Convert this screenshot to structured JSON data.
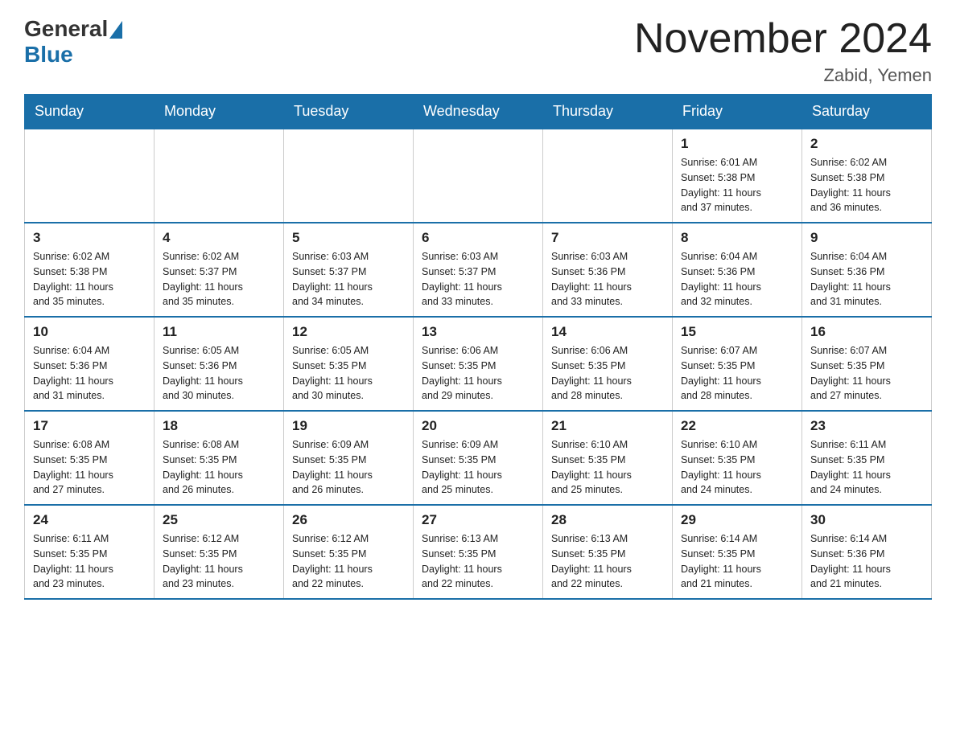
{
  "logo": {
    "general": "General",
    "blue": "Blue"
  },
  "title": "November 2024",
  "location": "Zabid, Yemen",
  "days_of_week": [
    "Sunday",
    "Monday",
    "Tuesday",
    "Wednesday",
    "Thursday",
    "Friday",
    "Saturday"
  ],
  "weeks": [
    [
      {
        "day": "",
        "info": ""
      },
      {
        "day": "",
        "info": ""
      },
      {
        "day": "",
        "info": ""
      },
      {
        "day": "",
        "info": ""
      },
      {
        "day": "",
        "info": ""
      },
      {
        "day": "1",
        "info": "Sunrise: 6:01 AM\nSunset: 5:38 PM\nDaylight: 11 hours\nand 37 minutes."
      },
      {
        "day": "2",
        "info": "Sunrise: 6:02 AM\nSunset: 5:38 PM\nDaylight: 11 hours\nand 36 minutes."
      }
    ],
    [
      {
        "day": "3",
        "info": "Sunrise: 6:02 AM\nSunset: 5:38 PM\nDaylight: 11 hours\nand 35 minutes."
      },
      {
        "day": "4",
        "info": "Sunrise: 6:02 AM\nSunset: 5:37 PM\nDaylight: 11 hours\nand 35 minutes."
      },
      {
        "day": "5",
        "info": "Sunrise: 6:03 AM\nSunset: 5:37 PM\nDaylight: 11 hours\nand 34 minutes."
      },
      {
        "day": "6",
        "info": "Sunrise: 6:03 AM\nSunset: 5:37 PM\nDaylight: 11 hours\nand 33 minutes."
      },
      {
        "day": "7",
        "info": "Sunrise: 6:03 AM\nSunset: 5:36 PM\nDaylight: 11 hours\nand 33 minutes."
      },
      {
        "day": "8",
        "info": "Sunrise: 6:04 AM\nSunset: 5:36 PM\nDaylight: 11 hours\nand 32 minutes."
      },
      {
        "day": "9",
        "info": "Sunrise: 6:04 AM\nSunset: 5:36 PM\nDaylight: 11 hours\nand 31 minutes."
      }
    ],
    [
      {
        "day": "10",
        "info": "Sunrise: 6:04 AM\nSunset: 5:36 PM\nDaylight: 11 hours\nand 31 minutes."
      },
      {
        "day": "11",
        "info": "Sunrise: 6:05 AM\nSunset: 5:36 PM\nDaylight: 11 hours\nand 30 minutes."
      },
      {
        "day": "12",
        "info": "Sunrise: 6:05 AM\nSunset: 5:35 PM\nDaylight: 11 hours\nand 30 minutes."
      },
      {
        "day": "13",
        "info": "Sunrise: 6:06 AM\nSunset: 5:35 PM\nDaylight: 11 hours\nand 29 minutes."
      },
      {
        "day": "14",
        "info": "Sunrise: 6:06 AM\nSunset: 5:35 PM\nDaylight: 11 hours\nand 28 minutes."
      },
      {
        "day": "15",
        "info": "Sunrise: 6:07 AM\nSunset: 5:35 PM\nDaylight: 11 hours\nand 28 minutes."
      },
      {
        "day": "16",
        "info": "Sunrise: 6:07 AM\nSunset: 5:35 PM\nDaylight: 11 hours\nand 27 minutes."
      }
    ],
    [
      {
        "day": "17",
        "info": "Sunrise: 6:08 AM\nSunset: 5:35 PM\nDaylight: 11 hours\nand 27 minutes."
      },
      {
        "day": "18",
        "info": "Sunrise: 6:08 AM\nSunset: 5:35 PM\nDaylight: 11 hours\nand 26 minutes."
      },
      {
        "day": "19",
        "info": "Sunrise: 6:09 AM\nSunset: 5:35 PM\nDaylight: 11 hours\nand 26 minutes."
      },
      {
        "day": "20",
        "info": "Sunrise: 6:09 AM\nSunset: 5:35 PM\nDaylight: 11 hours\nand 25 minutes."
      },
      {
        "day": "21",
        "info": "Sunrise: 6:10 AM\nSunset: 5:35 PM\nDaylight: 11 hours\nand 25 minutes."
      },
      {
        "day": "22",
        "info": "Sunrise: 6:10 AM\nSunset: 5:35 PM\nDaylight: 11 hours\nand 24 minutes."
      },
      {
        "day": "23",
        "info": "Sunrise: 6:11 AM\nSunset: 5:35 PM\nDaylight: 11 hours\nand 24 minutes."
      }
    ],
    [
      {
        "day": "24",
        "info": "Sunrise: 6:11 AM\nSunset: 5:35 PM\nDaylight: 11 hours\nand 23 minutes."
      },
      {
        "day": "25",
        "info": "Sunrise: 6:12 AM\nSunset: 5:35 PM\nDaylight: 11 hours\nand 23 minutes."
      },
      {
        "day": "26",
        "info": "Sunrise: 6:12 AM\nSunset: 5:35 PM\nDaylight: 11 hours\nand 22 minutes."
      },
      {
        "day": "27",
        "info": "Sunrise: 6:13 AM\nSunset: 5:35 PM\nDaylight: 11 hours\nand 22 minutes."
      },
      {
        "day": "28",
        "info": "Sunrise: 6:13 AM\nSunset: 5:35 PM\nDaylight: 11 hours\nand 22 minutes."
      },
      {
        "day": "29",
        "info": "Sunrise: 6:14 AM\nSunset: 5:35 PM\nDaylight: 11 hours\nand 21 minutes."
      },
      {
        "day": "30",
        "info": "Sunrise: 6:14 AM\nSunset: 5:36 PM\nDaylight: 11 hours\nand 21 minutes."
      }
    ]
  ]
}
